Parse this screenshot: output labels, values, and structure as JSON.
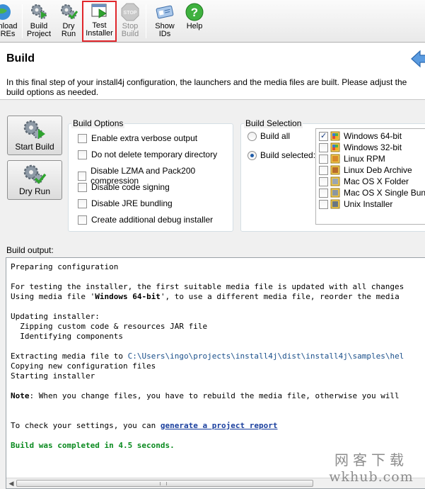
{
  "toolbar": {
    "download_jres": "nload\nREs",
    "build_project": "Build\nProject",
    "dry_run": "Dry\nRun",
    "test_installer": "Test\nInstaller",
    "stop_build": "Stop\nBuild",
    "show_ids": "Show\nIDs",
    "help": "Help"
  },
  "header": {
    "title": "Build",
    "description": "In this final step of your install4j configuration, the launchers and the media files are built. Please adjust the build options as needed."
  },
  "actions": {
    "start_build": "Start Build",
    "dry_run": "Dry Run"
  },
  "build_options": {
    "title": "Build Options",
    "items": [
      "Enable extra verbose output",
      "Do not delete temporary directory",
      "Disable LZMA and Pack200 compression",
      "Disable code signing",
      "Disable JRE bundling",
      "Create additional debug installer"
    ]
  },
  "build_selection": {
    "title": "Build Selection",
    "build_all": "Build all",
    "build_selected": "Build selected:",
    "media": [
      {
        "label": "Windows 64-bit",
        "checked": true
      },
      {
        "label": "Windows 32-bit",
        "checked": false
      },
      {
        "label": "Linux RPM",
        "checked": false
      },
      {
        "label": "Linux Deb Archive",
        "checked": false
      },
      {
        "label": "Mac OS X Folder",
        "checked": false
      },
      {
        "label": "Mac OS X Single Bundle",
        "checked": false
      },
      {
        "label": "Unix Installer",
        "checked": false
      }
    ]
  },
  "output": {
    "label": "Build output:",
    "l1": "Preparing configuration",
    "l2": "For testing the installer, the first suitable media file is updated with all changes",
    "l3a": "Using media file '",
    "l3b": "Windows 64-bit",
    "l3c": "', to use a different media file, reorder the media",
    "l4": "Updating installer:",
    "l5": "  Zipping custom code & resources JAR file",
    "l6": "  Identifying components",
    "l7a": "Extracting media file to ",
    "l7b": "C:\\Users\\ingo\\projects\\install4j\\dist\\install4j\\samples\\hel",
    "l8": "Copying new configuration files",
    "l9": "Starting installer",
    "l10a": "Note",
    "l10b": ": When you change files, you have to rebuild the media file, otherwise you will",
    "l11a": "To check your settings, you can ",
    "l11b": "generate a project report",
    "l12": "Build was completed in 4.5 seconds."
  },
  "watermark": {
    "line1": "网客下载",
    "line2": "wkhub.com"
  }
}
